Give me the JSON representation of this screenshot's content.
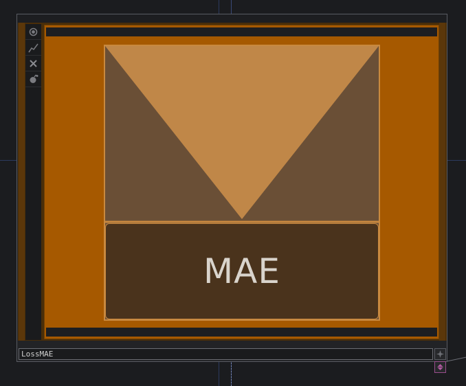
{
  "node": {
    "name": "LossMAE",
    "icon_label": "MAE"
  },
  "side_toolbar": {
    "items": [
      {
        "icon": "viewer-toggle-icon"
      },
      {
        "icon": "graph-icon"
      },
      {
        "icon": "close-icon"
      },
      {
        "icon": "python-icon"
      }
    ]
  },
  "colors": {
    "background": "#1b1c1f",
    "viewer_bg": "#a65900",
    "triangle_top": "#c08748",
    "triangle_sides": "#6a4f36",
    "label_panel": "#4a331c",
    "accent_border": "#c9893f",
    "connector_out": "#9a4d8e"
  }
}
